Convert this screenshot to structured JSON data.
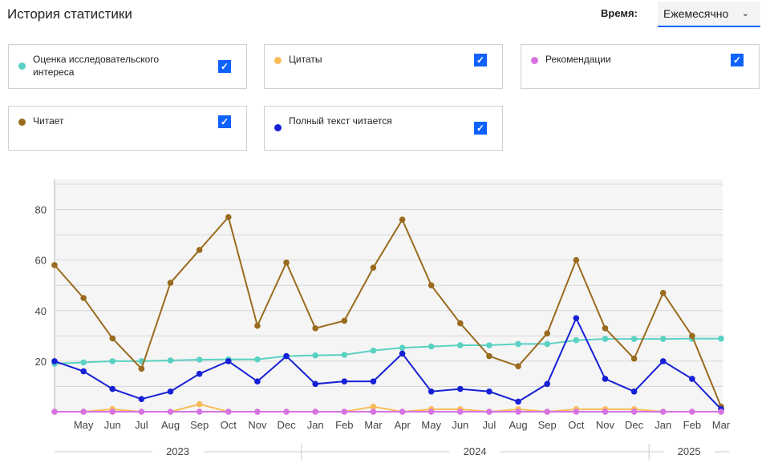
{
  "header": {
    "title": "История статистики",
    "time_label": "Время:",
    "period": "Ежемесячно"
  },
  "legend": [
    {
      "label": "Оценка исследовательского интереса",
      "color": "#5ad1c3",
      "checked": true
    },
    {
      "label": "Цитаты",
      "color": "#f9bb5a",
      "checked": true
    },
    {
      "label": "Рекомендации",
      "color": "#d673e3",
      "checked": true
    },
    {
      "label": "Читает",
      "color": "#9a6b1e",
      "checked": true
    },
    {
      "label": "Полный текст читается",
      "color": "#1620d4",
      "checked": true
    }
  ],
  "chart_data": {
    "type": "line",
    "x": [
      "",
      "May",
      "Jun",
      "Jul",
      "Aug",
      "Sep",
      "Oct",
      "Nov",
      "Dec",
      "Jan",
      "Feb",
      "Mar",
      "Apr",
      "May",
      "Jun",
      "Jul",
      "Aug",
      "Sep",
      "Oct",
      "Nov",
      "Dec",
      "Jan",
      "Feb",
      "Mar"
    ],
    "years": [
      {
        "label": "2023",
        "from": 0,
        "to": 8
      },
      {
        "label": "2024",
        "from": 9,
        "to": 20
      },
      {
        "label": "2025",
        "from": 21,
        "to": 23
      }
    ],
    "yticks": [
      20,
      40,
      60,
      80
    ],
    "ylim": [
      0,
      90
    ],
    "grid": true,
    "series": [
      {
        "name": "Оценка исследовательского интереса",
        "color": "#5ad1c3",
        "values": [
          19,
          19.5,
          20,
          20,
          20.3,
          20.6,
          20.7,
          20.7,
          22,
          22.3,
          22.5,
          24.2,
          25.3,
          25.8,
          26.3,
          26.3,
          26.8,
          26.8,
          28.3,
          28.8,
          28.8,
          28.8,
          28.9,
          28.9
        ]
      },
      {
        "name": "Цитаты",
        "color": "#f9bb5a",
        "values": [
          0,
          0,
          1,
          0,
          0,
          3,
          0,
          0,
          0,
          0,
          0,
          2,
          0,
          1,
          1,
          0,
          1,
          0,
          1,
          1,
          1,
          0,
          0,
          0
        ]
      },
      {
        "name": "Читает",
        "color": "#9a6b1e",
        "values": [
          58,
          45,
          29,
          17,
          51,
          64,
          77,
          34,
          59,
          33,
          36,
          57,
          76,
          50,
          35,
          22,
          18,
          31,
          60,
          33,
          21,
          47,
          30,
          2
        ]
      },
      {
        "name": "Полный текст читается",
        "color": "#1620d4",
        "values": [
          20,
          16,
          9,
          5,
          8,
          15,
          20,
          12,
          22,
          11,
          12,
          12,
          23,
          8,
          9,
          8,
          4,
          11,
          37,
          13,
          8,
          20,
          13,
          1
        ]
      },
      {
        "name": "Рекомендации",
        "color": "#d673e3",
        "values": [
          0,
          0,
          0,
          0,
          0,
          0,
          0,
          0,
          0,
          0,
          0,
          0,
          0,
          0,
          0,
          0,
          0,
          0,
          0,
          0,
          0,
          0,
          0,
          0
        ]
      }
    ]
  }
}
